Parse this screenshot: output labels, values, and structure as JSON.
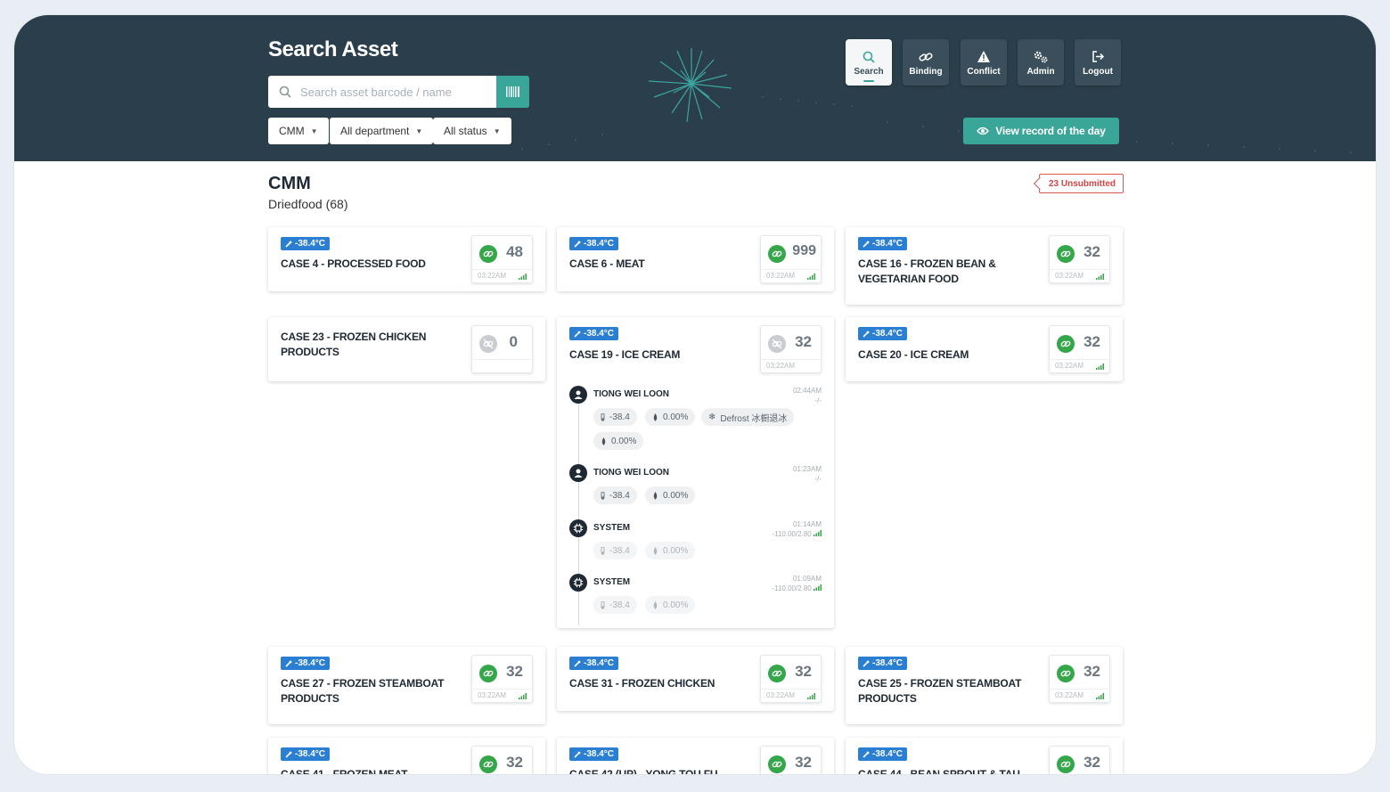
{
  "header": {
    "title": "Search Asset",
    "search_placeholder": "Search asset barcode / name",
    "filters": [
      "CMM",
      "All department",
      "All status"
    ],
    "nav": [
      {
        "label": "Search",
        "icon": "search-icon",
        "active": true
      },
      {
        "label": "Binding",
        "icon": "link-icon",
        "active": false
      },
      {
        "label": "Conflict",
        "icon": "warning-icon",
        "active": false
      },
      {
        "label": "Admin",
        "icon": "gears-icon",
        "active": false
      },
      {
        "label": "Logout",
        "icon": "logout-icon",
        "active": false
      }
    ],
    "record_button": "View record of the day"
  },
  "location": {
    "title": "CMM",
    "subtitle": "Driedfood (68)",
    "unsubmitted": "23 Unsubmitted"
  },
  "cards": [
    {
      "temp": "-38.4°C",
      "name": "CASE 4 - PROCESSED FOOD",
      "count": "48",
      "time": "03:22AM",
      "linked": true
    },
    {
      "temp": "-38.4°C",
      "name": "CASE 6 - MEAT",
      "count": "999",
      "time": "03:22AM",
      "linked": true
    },
    {
      "temp": "-38.4°C",
      "name": "CASE 16 - FROZEN BEAN & VEGETARIAN FOOD",
      "count": "32",
      "time": "03:22AM",
      "linked": true
    },
    {
      "temp": "",
      "name": "CASE 23 - FROZEN CHICKEN PRODUCTS",
      "count": "0",
      "time": "",
      "linked": false
    },
    {
      "temp": "-38.4°C",
      "name": "CASE 19 - ICE CREAM",
      "count": "32",
      "time": "03:22AM",
      "linked": false
    },
    {
      "temp": "-38.4°C",
      "name": "CASE 20 - ICE CREAM",
      "count": "32",
      "time": "03:22AM",
      "linked": true
    },
    {
      "temp": "-38.4°C",
      "name": "CASE 27 - FROZEN STEAMBOAT PRODUCTS",
      "count": "32",
      "time": "03:22AM",
      "linked": true
    },
    {
      "temp": "-38.4°C",
      "name": "CASE 31 - FROZEN CHICKEN",
      "count": "32",
      "time": "03:22AM",
      "linked": true
    },
    {
      "temp": "-38.4°C",
      "name": "CASE 25 - FROZEN STEAMBOAT PRODUCTS",
      "count": "32",
      "time": "03:22AM",
      "linked": true
    },
    {
      "temp": "-38.4°C",
      "name": "CASE 41 - FROZEN MEAT",
      "count": "32",
      "time": "",
      "linked": true
    },
    {
      "temp": "-38.4°C",
      "name": "CASE 42 (UP) - YONG TOU FU",
      "count": "32",
      "time": "",
      "linked": true
    },
    {
      "temp": "-38.4°C",
      "name": "CASE 44 - BEAN SPROUT & TAU",
      "count": "32",
      "time": "",
      "linked": true
    }
  ],
  "timeline": [
    {
      "name": "TIONG WEI LOON",
      "time": "02:44AM",
      "sub": "-/-",
      "temp": "-38.4",
      "humidity": "0.00%",
      "extra": "Defrost 冰橱退冰",
      "extra2": "0.00%",
      "type": "user"
    },
    {
      "name": "TIONG WEI LOON",
      "time": "01:23AM",
      "sub": "-/-",
      "temp": "-38.4",
      "humidity": "0.00%",
      "type": "user"
    },
    {
      "name": "SYSTEM",
      "time": "01:14AM",
      "sub": "-110.00/2.80",
      "temp": "-38.4",
      "humidity": "0.00%",
      "type": "system"
    },
    {
      "name": "SYSTEM",
      "time": "01:09AM",
      "sub": "-110.00/2.80",
      "temp": "-38.4",
      "humidity": "0.00%",
      "type": "system"
    }
  ],
  "colors": {
    "header_bg": "#2a3f4b",
    "accent": "#3aa69a",
    "temp_badge": "#2b7fd3",
    "link_green": "#35a64a",
    "alert_red": "#d64545"
  }
}
